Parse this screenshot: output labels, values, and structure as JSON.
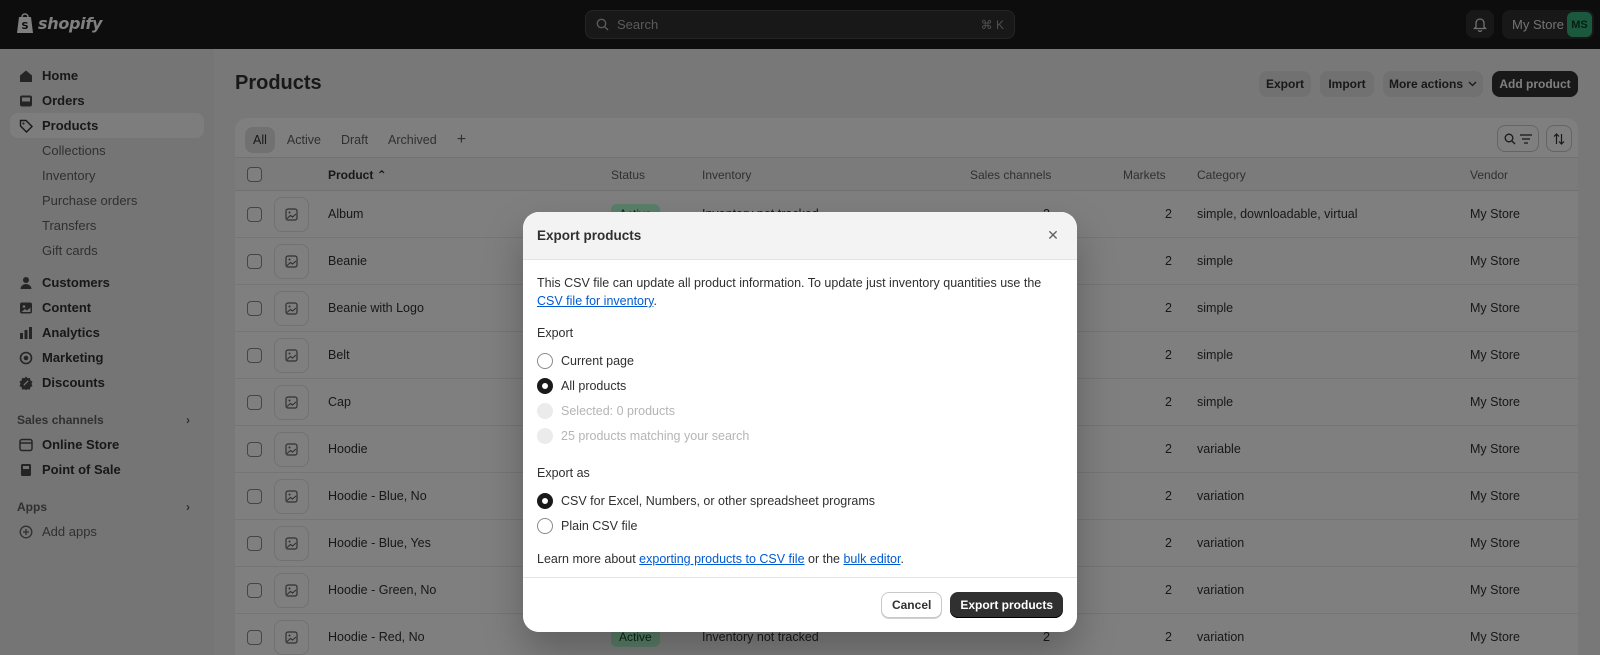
{
  "topbar": {
    "brand": "shopify",
    "search_placeholder": "Search",
    "search_shortcut": "⌘ K",
    "store_name": "My Store",
    "avatar_initials": "MS"
  },
  "sidebar": {
    "main_items": [
      {
        "label": "Home",
        "icon": "home-icon"
      },
      {
        "label": "Orders",
        "icon": "inbox-icon"
      },
      {
        "label": "Products",
        "icon": "tag-icon",
        "active": true
      }
    ],
    "product_subitems": [
      "Collections",
      "Inventory",
      "Purchase orders",
      "Transfers",
      "Gift cards"
    ],
    "more_items": [
      {
        "label": "Customers",
        "icon": "person-icon"
      },
      {
        "label": "Content",
        "icon": "content-icon"
      },
      {
        "label": "Analytics",
        "icon": "analytics-icon"
      },
      {
        "label": "Marketing",
        "icon": "target-icon"
      },
      {
        "label": "Discounts",
        "icon": "discount-icon"
      }
    ],
    "sales_channels_title": "Sales channels",
    "sales_channels": [
      {
        "label": "Online Store",
        "icon": "store-icon"
      },
      {
        "label": "Point of Sale",
        "icon": "pos-icon"
      }
    ],
    "apps_title": "Apps",
    "add_apps": "Add apps"
  },
  "header": {
    "title": "Products",
    "export": "Export",
    "import": "Import",
    "more_actions": "More actions",
    "add_product": "Add product"
  },
  "tabs": [
    "All",
    "Active",
    "Draft",
    "Archived"
  ],
  "table": {
    "columns": {
      "product": "Product",
      "status": "Status",
      "inventory": "Inventory",
      "sales_channels": "Sales channels",
      "markets": "Markets",
      "category": "Category",
      "vendor": "Vendor"
    },
    "rows": [
      {
        "product": "Album",
        "status": "Active",
        "inventory": "Inventory not tracked",
        "channels": "2",
        "markets": "2",
        "category": "simple, downloadable, virtual",
        "vendor": "My Store"
      },
      {
        "product": "Beanie",
        "status": "",
        "inventory": "",
        "channels": "",
        "markets": "2",
        "category": "simple",
        "vendor": "My Store"
      },
      {
        "product": "Beanie with Logo",
        "status": "",
        "inventory": "",
        "channels": "",
        "markets": "2",
        "category": "simple",
        "vendor": "My Store"
      },
      {
        "product": "Belt",
        "status": "",
        "inventory": "",
        "channels": "",
        "markets": "2",
        "category": "simple",
        "vendor": "My Store"
      },
      {
        "product": "Cap",
        "status": "",
        "inventory": "",
        "channels": "",
        "markets": "2",
        "category": "simple",
        "vendor": "My Store"
      },
      {
        "product": "Hoodie",
        "status": "",
        "inventory": "",
        "channels": "",
        "markets": "2",
        "category": "variable",
        "vendor": "My Store"
      },
      {
        "product": "Hoodie - Blue, No",
        "status": "",
        "inventory": "",
        "channels": "",
        "markets": "2",
        "category": "variation",
        "vendor": "My Store"
      },
      {
        "product": "Hoodie - Blue, Yes",
        "status": "",
        "inventory": "",
        "channels": "",
        "markets": "2",
        "category": "variation",
        "vendor": "My Store"
      },
      {
        "product": "Hoodie - Green, No",
        "status": "",
        "inventory": "",
        "channels": "",
        "markets": "2",
        "category": "variation",
        "vendor": "My Store"
      },
      {
        "product": "Hoodie - Red, No",
        "status": "Active",
        "inventory": "Inventory not tracked",
        "channels": "2",
        "markets": "2",
        "category": "variation",
        "vendor": "My Store"
      }
    ]
  },
  "modal": {
    "title": "Export products",
    "intro": "This CSV file can update all product information. To update just inventory quantities use the",
    "intro_link": "CSV file for inventory",
    "export_label": "Export",
    "export_options": [
      {
        "label": "Current page",
        "state": "off"
      },
      {
        "label": "All products",
        "state": "on"
      },
      {
        "label": "Selected: 0 products",
        "state": "disabled"
      },
      {
        "label": "25 products matching your search",
        "state": "disabled"
      }
    ],
    "export_as_label": "Export as",
    "export_as_options": [
      {
        "label": "CSV for Excel, Numbers, or other spreadsheet programs",
        "state": "on"
      },
      {
        "label": "Plain CSV file",
        "state": "off"
      }
    ],
    "learn_prefix": "Learn more about",
    "learn_link1": "exporting products to CSV file",
    "learn_mid": "or the",
    "learn_link2": "bulk editor",
    "cancel": "Cancel",
    "confirm": "Export products"
  },
  "colors": {
    "topbar": "#1a1a1a",
    "active_badge": "#b4fed2",
    "link": "#005bd3",
    "avatar": "#36b37e"
  }
}
